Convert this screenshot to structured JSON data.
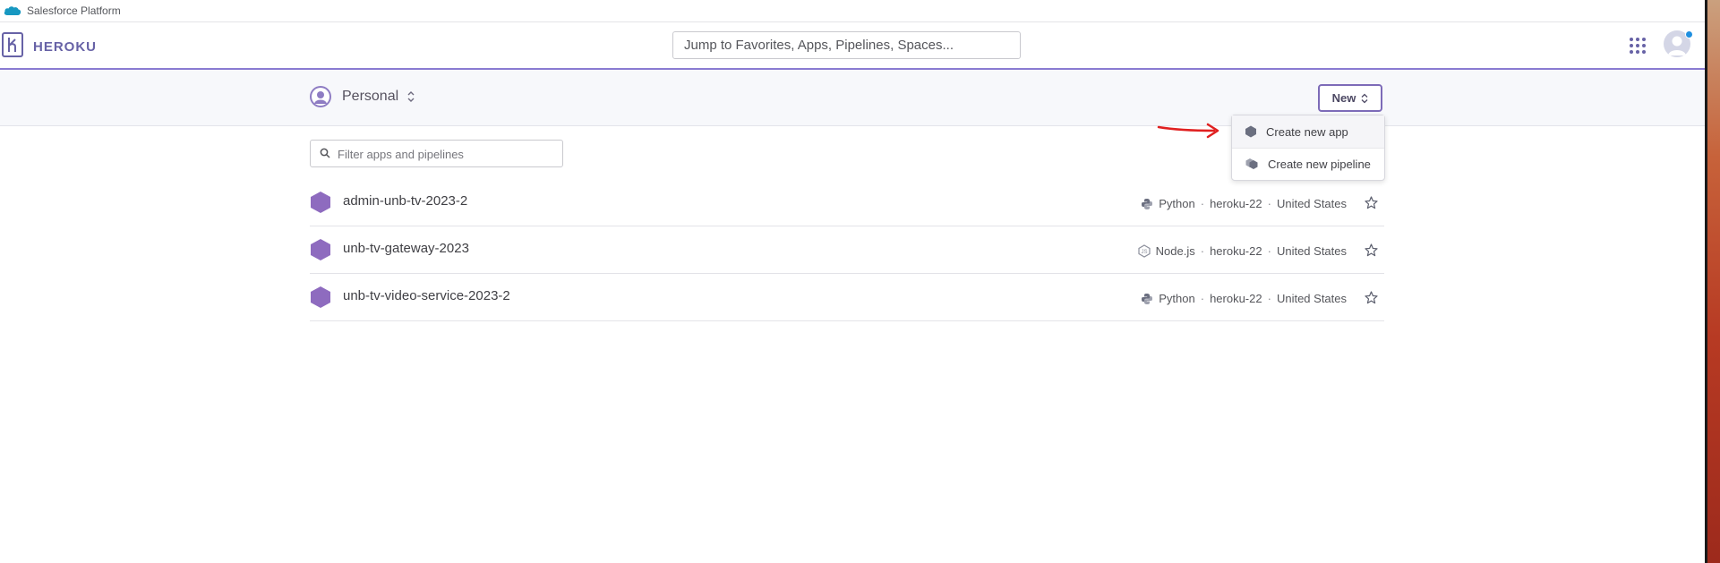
{
  "window": {
    "title": "Salesforce Platform"
  },
  "header": {
    "brand": "HEROKU",
    "search_placeholder": "Jump to Favorites, Apps, Pipelines, Spaces..."
  },
  "subheader": {
    "account": "Personal",
    "new_button": "New"
  },
  "dropdown": {
    "items": [
      {
        "label": "Create new app",
        "icon": "app-hex-icon"
      },
      {
        "label": "Create new pipeline",
        "icon": "pipeline-icon"
      }
    ]
  },
  "filter": {
    "placeholder": "Filter apps and pipelines"
  },
  "apps": [
    {
      "name": "admin-unb-tv-2023-2",
      "language": "Python",
      "language_icon": "python-icon",
      "stack": "heroku-22",
      "region": "United States"
    },
    {
      "name": "unb-tv-gateway-2023",
      "language": "Node.js",
      "language_icon": "nodejs-icon",
      "stack": "heroku-22",
      "region": "United States"
    },
    {
      "name": "unb-tv-video-service-2023-2",
      "language": "Python",
      "language_icon": "python-icon",
      "stack": "heroku-22",
      "region": "United States"
    }
  ],
  "colors": {
    "brand_purple": "#6762a6",
    "app_hex": "#8e6bbf",
    "annotation_arrow": "#e02020",
    "notification_dot": "#1f8fe0"
  }
}
